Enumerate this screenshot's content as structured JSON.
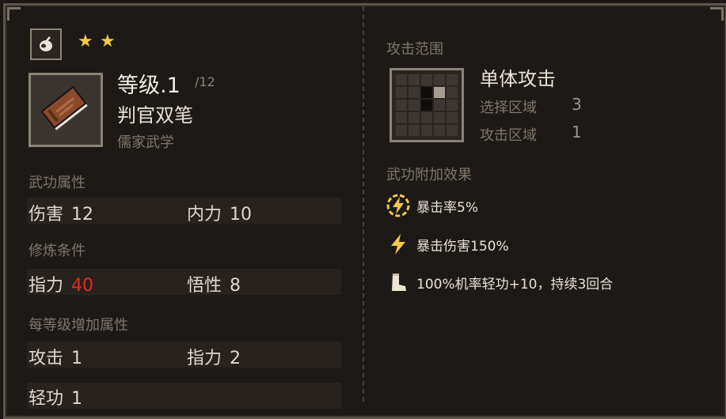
{
  "card": {
    "type_icon": "brush-icon",
    "stars": 2,
    "level_label": "等级.1",
    "level_max": "/12",
    "name": "判官双笔",
    "school": "儒家武学",
    "item_icon": "book-icon"
  },
  "attributes": {
    "title": "武功属性",
    "items": [
      {
        "label": "伤害",
        "value": "12"
      },
      {
        "label": "内力",
        "value": "10"
      }
    ]
  },
  "requirements": {
    "title": "修炼条件",
    "items": [
      {
        "label": "指力",
        "value": "40",
        "color": "#e02a24"
      },
      {
        "label": "悟性",
        "value": "8"
      }
    ]
  },
  "per_level": {
    "title": "每等级增加属性",
    "items": [
      {
        "label": "攻击",
        "value": "1"
      },
      {
        "label": "指力",
        "value": "2"
      },
      {
        "label": "轻功",
        "value": "1"
      }
    ]
  },
  "attack_range": {
    "title": "攻击范围",
    "type": "单体攻击",
    "select_label": "选择区域",
    "select_value": "3",
    "attack_label": "攻击区域",
    "attack_value": "1"
  },
  "bonus_effects": {
    "title": "武功附加效果",
    "items": [
      {
        "icon": "lightning-circle-icon",
        "text": "暴击率5%"
      },
      {
        "icon": "lightning-icon",
        "text": "暴击伤害150%"
      },
      {
        "icon": "boot-icon",
        "text": "100%机率轻功+10，持续3回合"
      }
    ]
  },
  "colors": {
    "accent_gold": "#f2c94c",
    "warning_red": "#e02a24"
  }
}
